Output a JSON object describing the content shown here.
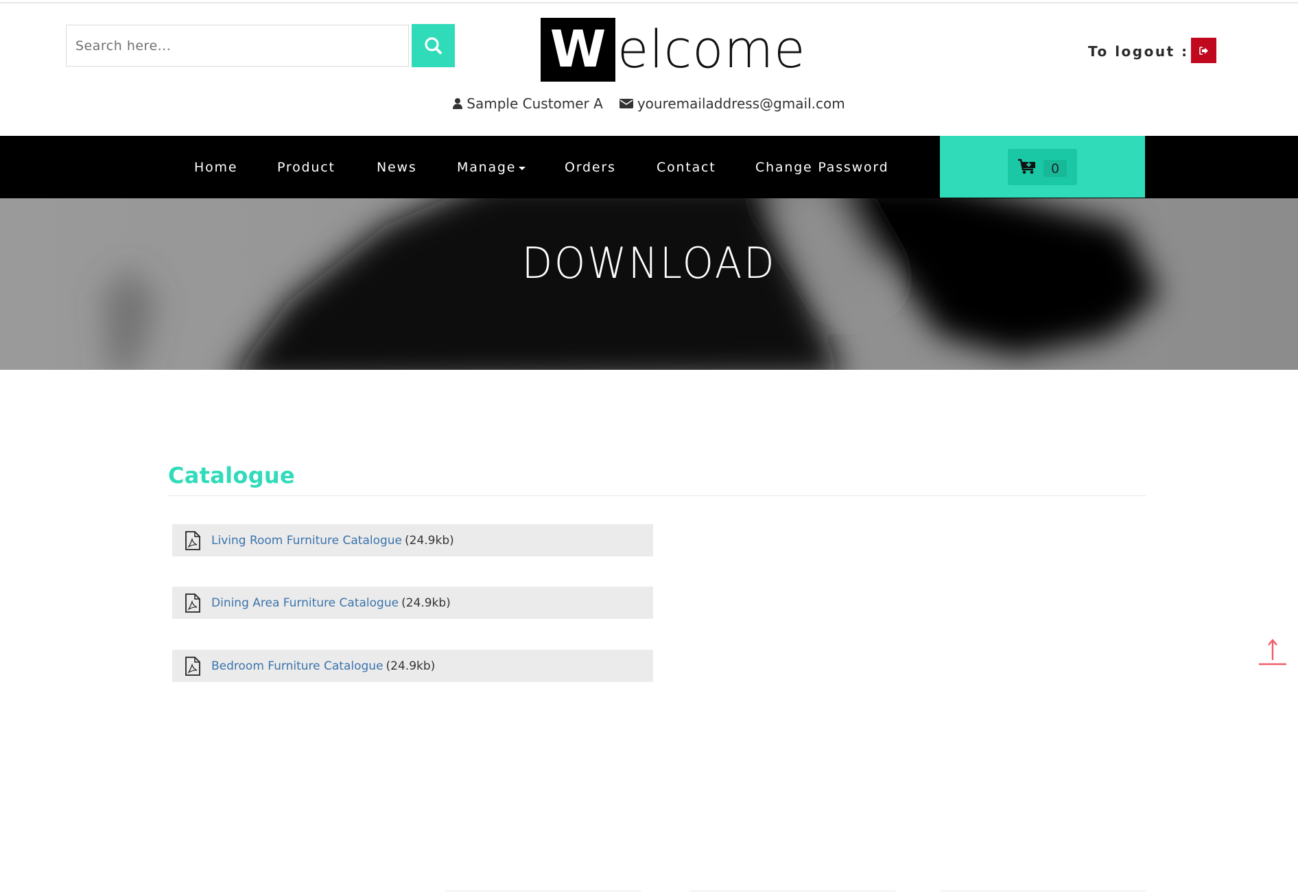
{
  "header": {
    "search": {
      "placeholder": "Search here...",
      "value": "",
      "button_icon": "search-icon"
    },
    "logo": {
      "initial": "W",
      "rest": "elcome"
    },
    "user": {
      "name": "Sample Customer A",
      "name_icon": "user-icon",
      "email": "youremailaddress@gmail.com",
      "email_icon": "envelope-icon"
    },
    "logout": {
      "label": "To logout :",
      "icon": "sign-out-icon",
      "color": "#c0081f"
    }
  },
  "nav": {
    "items": [
      {
        "label": "Home"
      },
      {
        "label": "Product"
      },
      {
        "label": "News"
      },
      {
        "label": "Manage",
        "has_dropdown": true
      },
      {
        "label": "Orders"
      },
      {
        "label": "Contact"
      },
      {
        "label": "Change Password"
      }
    ],
    "cart": {
      "icon": "cart-download-icon",
      "count": "0"
    }
  },
  "hero": {
    "title": "DOWNLOAD"
  },
  "catalogue": {
    "title": "Catalogue",
    "files": [
      {
        "name": "Living Room Furniture Catalogue",
        "size": "(24.9kb)",
        "icon": "pdf-file-icon"
      },
      {
        "name": "Dining Area Furniture Catalogue",
        "size": "(24.9kb)",
        "icon": "pdf-file-icon"
      },
      {
        "name": "Bedroom Furniture Catalogue",
        "size": "(24.9kb)",
        "icon": "pdf-file-icon"
      }
    ]
  },
  "back_to_top": {
    "icon": "arrow-up-icon",
    "color": "#f05a6a"
  },
  "colors": {
    "accent": "#30dbb9",
    "nav_bg": "#000000",
    "link": "#3a73ab",
    "row_bg": "#ebebeb"
  }
}
